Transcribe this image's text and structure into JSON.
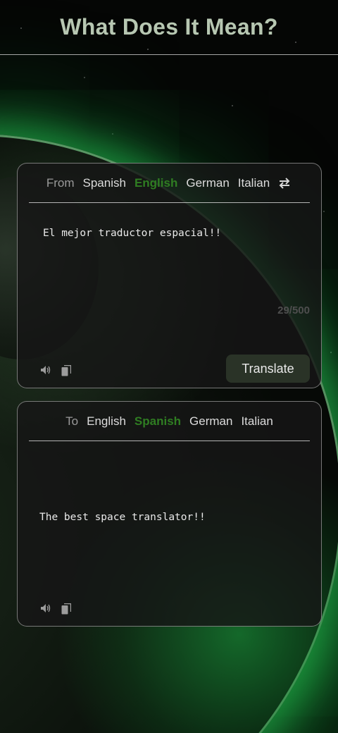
{
  "header": {
    "title": "What Does It Mean?"
  },
  "source": {
    "prefix": "From",
    "languages": [
      "Spanish",
      "English",
      "German",
      "Italian"
    ],
    "active": "English",
    "text": "El mejor traductor espacial!!",
    "char_count": "29/500",
    "translate_label": "Translate",
    "icons": [
      "speaker-icon",
      "copy-icon",
      "swap-icon"
    ]
  },
  "target": {
    "prefix": "To",
    "languages": [
      "English",
      "Spanish",
      "German",
      "Italian"
    ],
    "active": "Spanish",
    "text": "The best space translator!!",
    "icons": [
      "speaker-icon",
      "copy-icon"
    ]
  },
  "colors": {
    "active_language": "#2f7d22",
    "title": "#b7c7b2",
    "button_bg": "#2a3327",
    "planet_glow": "#28d25a"
  }
}
